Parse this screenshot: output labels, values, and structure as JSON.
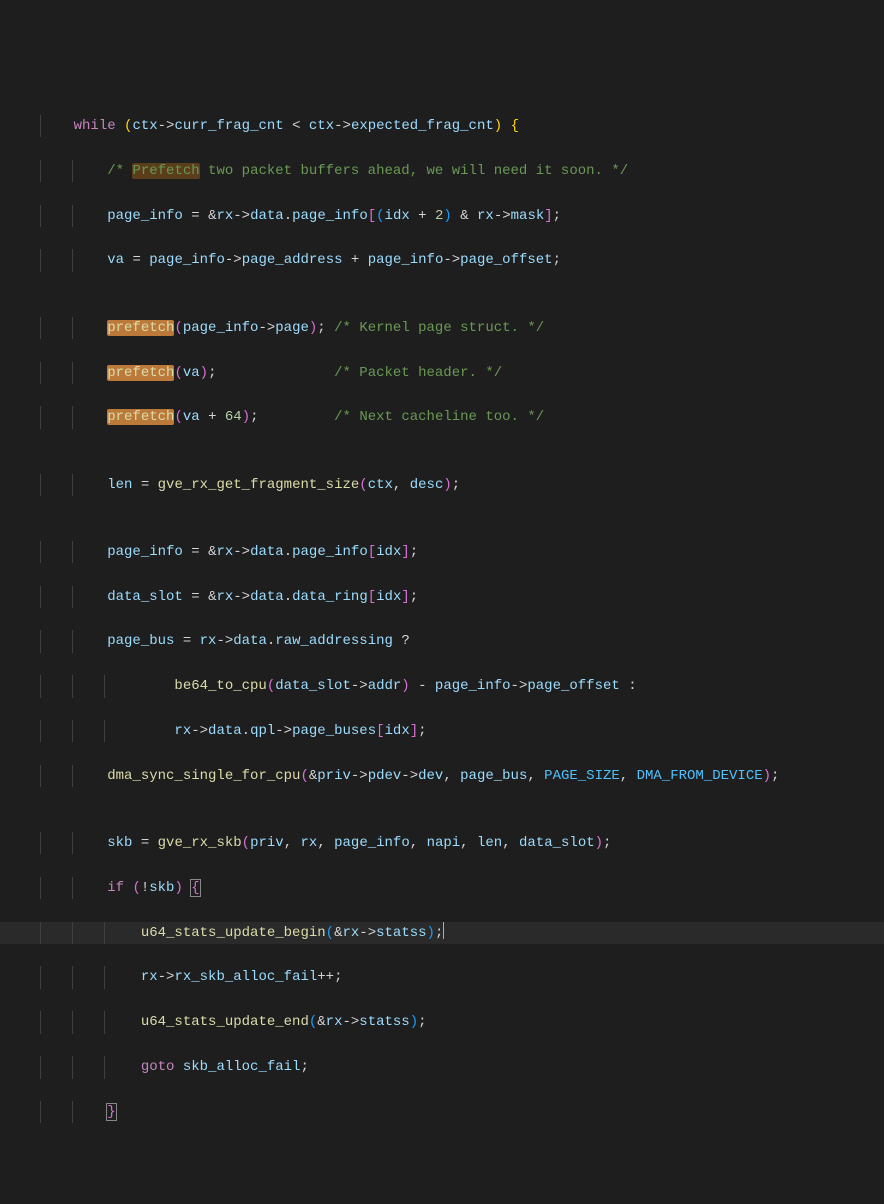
{
  "code": {
    "l1_while": "while",
    "l1_ctx1": "ctx",
    "l1_curr": "curr_frag_cnt",
    "l1_ctx2": "ctx",
    "l1_exp": "expected_frag_cnt",
    "l2_comment_pre": "/* ",
    "l2_prefetch_word": "Prefetch",
    "l2_comment_post": " two packet buffers ahead, we will need it soon. */",
    "l3_pageinfo": "page_info",
    "l3_rx": "rx",
    "l3_data": "data",
    "l3_pi": "page_info",
    "l3_idx": "idx",
    "l3_two": "2",
    "l3_rx2": "rx",
    "l3_mask": "mask",
    "l4_va": "va",
    "l4_pi": "page_info",
    "l4_pa": "page_address",
    "l4_pi2": "page_info",
    "l4_po": "page_offset",
    "l6_prefetch": "prefetch",
    "l6_pi": "page_info",
    "l6_page": "page",
    "l6_comment": "/* Kernel page struct. */",
    "l7_prefetch": "prefetch",
    "l7_va": "va",
    "l7_comment": "/* Packet header. */",
    "l8_prefetch": "prefetch",
    "l8_va": "va",
    "l8_num": "64",
    "l8_comment": "/* Next cacheline too. */",
    "l10_len": "len",
    "l10_fn": "gve_rx_get_fragment_size",
    "l10_ctx": "ctx",
    "l10_desc": "desc",
    "l12_pi": "page_info",
    "l12_rx": "rx",
    "l12_data": "data",
    "l12_pi2": "page_info",
    "l12_idx": "idx",
    "l13_ds": "data_slot",
    "l13_rx": "rx",
    "l13_data": "data",
    "l13_dr": "data_ring",
    "l13_idx": "idx",
    "l14_pb": "page_bus",
    "l14_rx": "rx",
    "l14_data": "data",
    "l14_ra": "raw_addressing",
    "l15_fn": "be64_to_cpu",
    "l15_ds": "data_slot",
    "l15_addr": "addr",
    "l15_pi": "page_info",
    "l15_po": "page_offset",
    "l16_rx": "rx",
    "l16_data": "data",
    "l16_qpl": "qpl",
    "l16_pb": "page_buses",
    "l16_idx": "idx",
    "l17_fn": "dma_sync_single_for_cpu",
    "l17_priv": "priv",
    "l17_pdev": "pdev",
    "l17_dev": "dev",
    "l17_pb": "page_bus",
    "l17_ps": "PAGE_SIZE",
    "l17_dfd": "DMA_FROM_DEVICE",
    "l19_skb": "skb",
    "l19_fn": "gve_rx_skb",
    "l19_priv": "priv",
    "l19_rx": "rx",
    "l19_pi": "page_info",
    "l19_napi": "napi",
    "l19_len": "len",
    "l19_ds": "data_slot",
    "l20_if": "if",
    "l20_skb": "skb",
    "l21_fn": "u64_stats_update_begin",
    "l21_rx": "rx",
    "l21_statss": "statss",
    "l22_rx": "rx",
    "l22_fail": "rx_skb_alloc_fail",
    "l23_fn": "u64_stats_update_end",
    "l23_rx": "rx",
    "l23_statss": "statss",
    "l24_goto": "goto",
    "l24_label": "skb_alloc_fail"
  }
}
